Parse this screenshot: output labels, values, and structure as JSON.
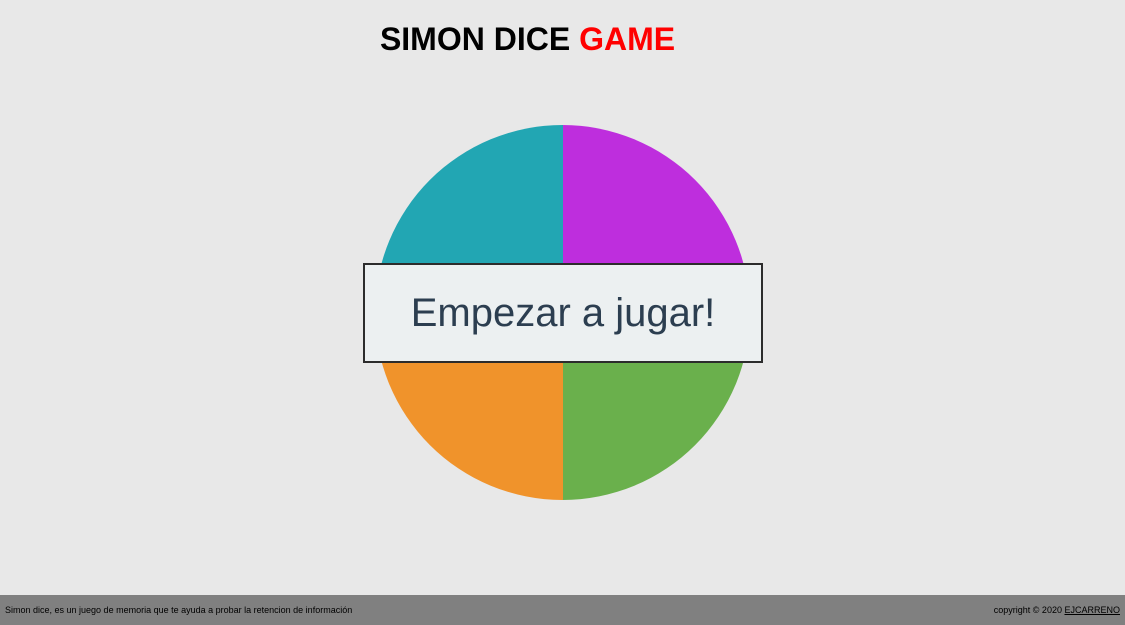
{
  "header": {
    "title_main": "SIMON DICE",
    "title_accent": "GAME",
    "accent_color": "#ff0000"
  },
  "board": {
    "colors": {
      "celeste": "#22a6b3",
      "violeta": "#be2edd",
      "naranja": "#f0932b",
      "verde": "#6ab04c"
    }
  },
  "start_button": {
    "label": "Empezar a jugar!"
  },
  "footer": {
    "description": "Simon dice, es un juego de memoria que te ayuda a probar la retencion de información",
    "copyright": "copyright © 2020",
    "author_link": "EJCARRENO"
  }
}
